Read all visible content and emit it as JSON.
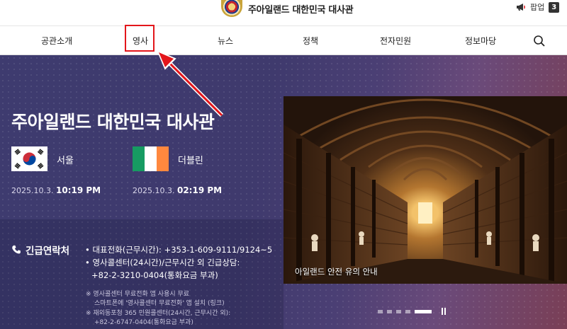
{
  "header": {
    "site_title": "주아일랜드 대한민국 대사관",
    "popup_label": "팝업",
    "popup_count": "3"
  },
  "nav": {
    "items": [
      "공관소개",
      "영사",
      "뉴스",
      "정책",
      "전자민원",
      "정보마당"
    ]
  },
  "hero": {
    "title": "주아일랜드 대한민국 대사관",
    "seoul": {
      "city": "서울",
      "date": "2025.10.3.",
      "time": "10:19 PM"
    },
    "dublin": {
      "city": "더블린",
      "date": "2025.10.3.",
      "time": "02:19 PM"
    }
  },
  "emergency": {
    "title": "긴급연락처",
    "line1": "• 대표전화(근무시간): +353-1-609-9111/9124~5",
    "line2": "• 영사콜센터(24시간)/근무시간 외 긴급상담:",
    "line3": "+82-2-3210-0404(통화요금 부과)",
    "note1": "※ 영사콜센터 무료전화 앱 사용시 무료",
    "note2": "스마트폰에 '영사콜센터 무료전화' 앱 설치 (링크)",
    "note3": "※ 재외동포청 365 민원콜센터(24시간, 근무시간 외):",
    "note4": "+82-2-6747-0404(통화요금 부과)"
  },
  "slider": {
    "caption": "아일랜드 안전 유의 안내",
    "active_index": 5,
    "total": 5
  },
  "colors": {
    "highlight": "#e3161b",
    "hero_bg": "#3f3a6d",
    "flag_ie_green": "#169b62",
    "flag_ie_orange": "#ff883e",
    "flag_kr_red": "#cd2e3a",
    "flag_kr_blue": "#0047a0"
  },
  "icons": [
    "emblem-icon",
    "megaphone-icon",
    "search-icon",
    "phone-icon",
    "pause-icon",
    "arrow-pointer"
  ]
}
